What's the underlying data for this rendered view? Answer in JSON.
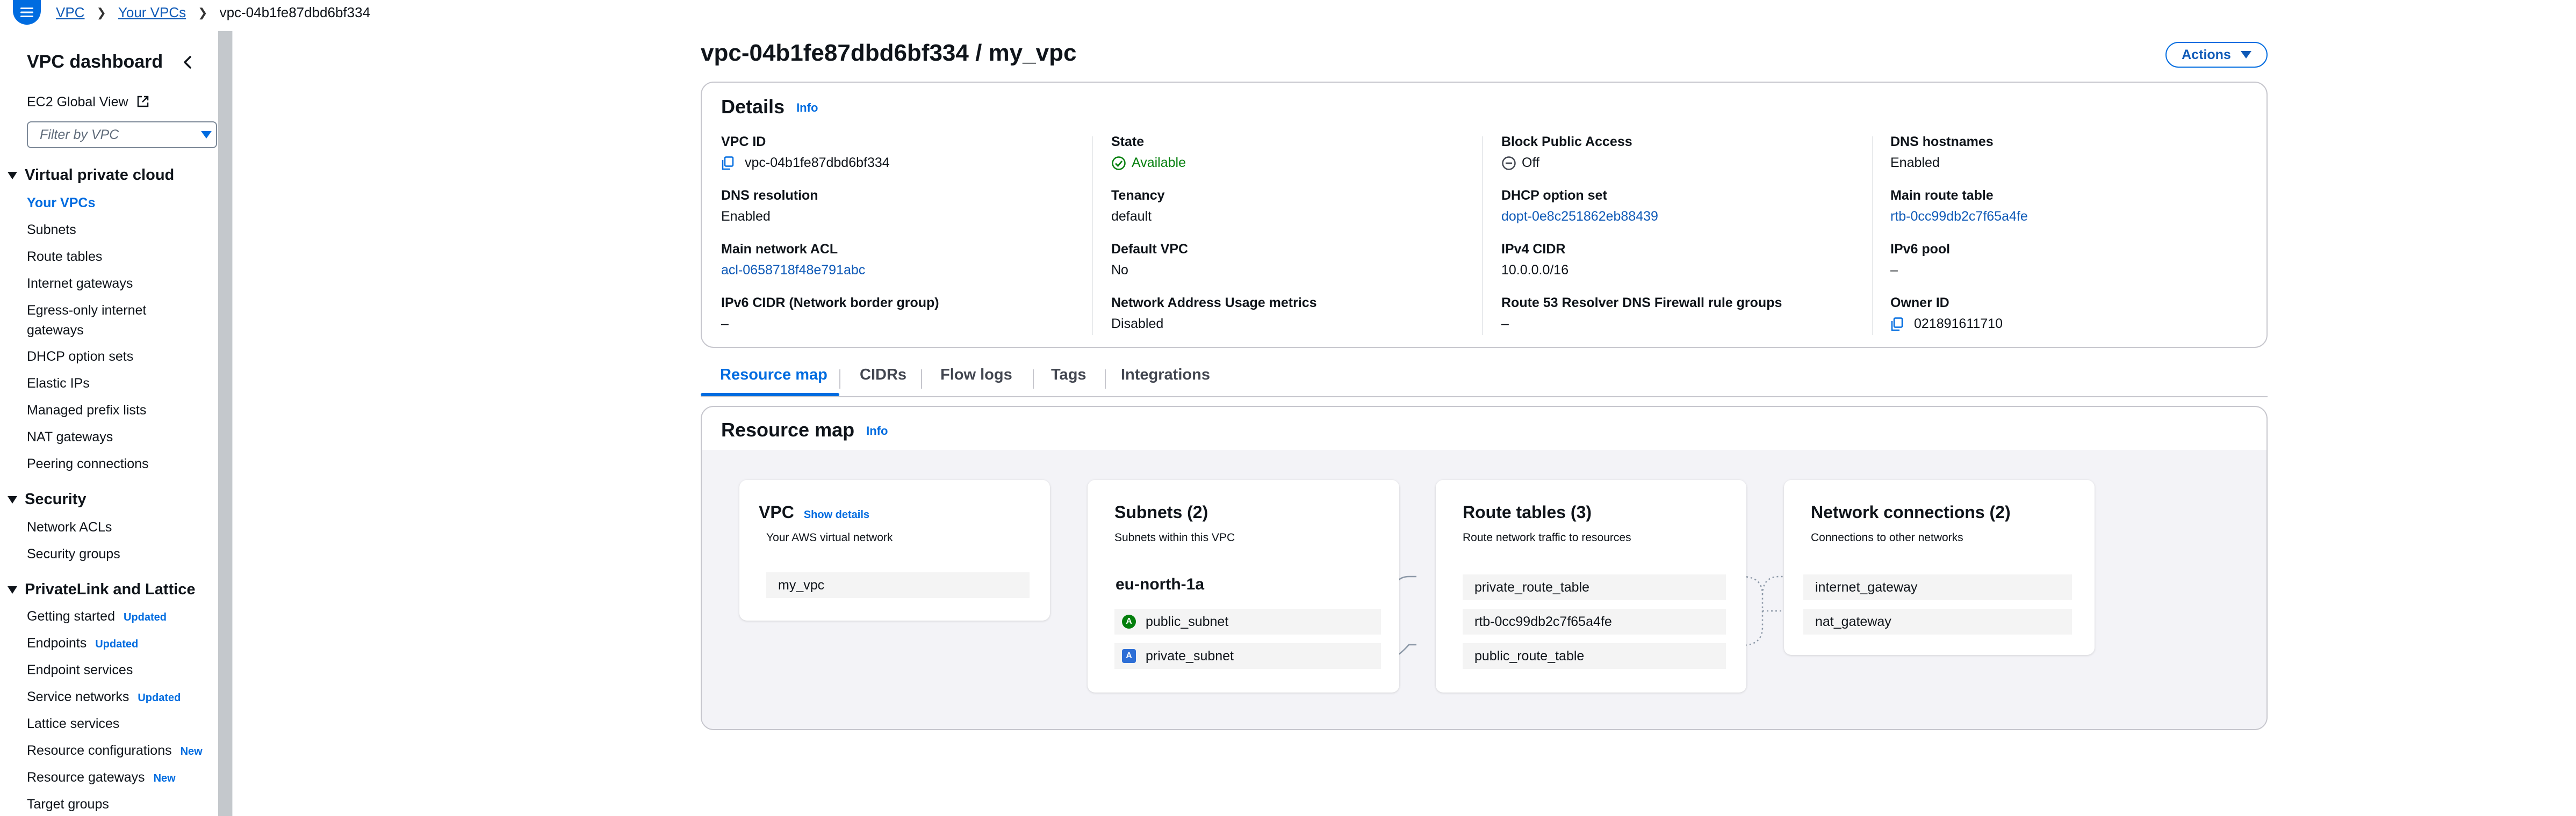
{
  "breadcrumb": {
    "items": [
      "VPC",
      "Your VPCs"
    ],
    "current": "vpc-04b1fe87dbd6bf334"
  },
  "sidebar": {
    "title": "VPC dashboard",
    "global_view": "EC2 Global View",
    "filter_placeholder": "Filter by VPC",
    "sections": [
      {
        "title": "Virtual private cloud",
        "items": [
          "Your VPCs",
          "Subnets",
          "Route tables",
          "Internet gateways",
          "Egress-only internet gateways",
          "DHCP option sets",
          "Elastic IPs",
          "Managed prefix lists",
          "NAT gateways",
          "Peering connections"
        ]
      },
      {
        "title": "Security",
        "items": [
          "Network ACLs",
          "Security groups"
        ]
      },
      {
        "title": "PrivateLink and Lattice",
        "items": [
          "Getting started",
          "Endpoints",
          "Endpoint services",
          "Service networks",
          "Lattice services",
          "Resource configurations",
          "Resource gateways",
          "Target groups"
        ]
      }
    ],
    "egress_line1": "Egress-only internet",
    "egress_line2": "gateways",
    "badges": {
      "updated": "Updated",
      "new": "New"
    }
  },
  "page": {
    "title": "vpc-04b1fe87dbd6bf334 / my_vpc",
    "actions_label": "Actions"
  },
  "details": {
    "title": "Details",
    "info": "Info",
    "fields": {
      "vpc_id": {
        "label": "VPC ID",
        "value": "vpc-04b1fe87dbd6bf334"
      },
      "state": {
        "label": "State",
        "value": "Available"
      },
      "block_public_access": {
        "label": "Block Public Access",
        "value": "Off"
      },
      "dns_hostnames": {
        "label": "DNS hostnames",
        "value": "Enabled"
      },
      "dns_resolution": {
        "label": "DNS resolution",
        "value": "Enabled"
      },
      "tenancy": {
        "label": "Tenancy",
        "value": "default"
      },
      "dhcp_option_set": {
        "label": "DHCP option set",
        "value": "dopt-0e8c251862eb88439"
      },
      "main_route_table": {
        "label": "Main route table",
        "value": "rtb-0cc99db2c7f65a4fe"
      },
      "main_network_acl": {
        "label": "Main network ACL",
        "value": "acl-0658718f48e791abc"
      },
      "default_vpc": {
        "label": "Default VPC",
        "value": "No"
      },
      "ipv4_cidr": {
        "label": "IPv4 CIDR",
        "value": "10.0.0.0/16"
      },
      "ipv6_pool": {
        "label": "IPv6 pool",
        "value": "–"
      },
      "ipv6_cidr": {
        "label": "IPv6 CIDR (Network border group)",
        "value": "–"
      },
      "nau_metrics": {
        "label": "Network Address Usage metrics",
        "value": "Disabled"
      },
      "route53_firewall": {
        "label": "Route 53 Resolver DNS Firewall rule groups",
        "value": "–"
      },
      "owner_id": {
        "label": "Owner ID",
        "value": "021891611710"
      }
    }
  },
  "tabs": [
    "Resource map",
    "CIDRs",
    "Flow logs",
    "Tags",
    "Integrations"
  ],
  "resource_map": {
    "title": "Resource map",
    "info": "Info",
    "vpc": {
      "title": "VPC",
      "show_details": "Show details",
      "subtitle": "Your AWS virtual network",
      "items": [
        "my_vpc"
      ]
    },
    "subnets": {
      "title": "Subnets (2)",
      "subtitle": "Subnets within this VPC",
      "az": "eu-north-1a",
      "items": [
        "public_subnet",
        "private_subnet"
      ],
      "badge": "A"
    },
    "route_tables": {
      "title": "Route tables (3)",
      "subtitle": "Route network traffic to resources",
      "items": [
        "private_route_table",
        "rtb-0cc99db2c7f65a4fe",
        "public_route_table"
      ]
    },
    "network_connections": {
      "title": "Network connections (2)",
      "subtitle": "Connections to other networks",
      "items": [
        "internet_gateway",
        "nat_gateway"
      ]
    }
  },
  "colors": {
    "accent": "#006ce0",
    "link": "#0f5ab7",
    "success": "#037f0c",
    "border": "#c6c6cd"
  }
}
